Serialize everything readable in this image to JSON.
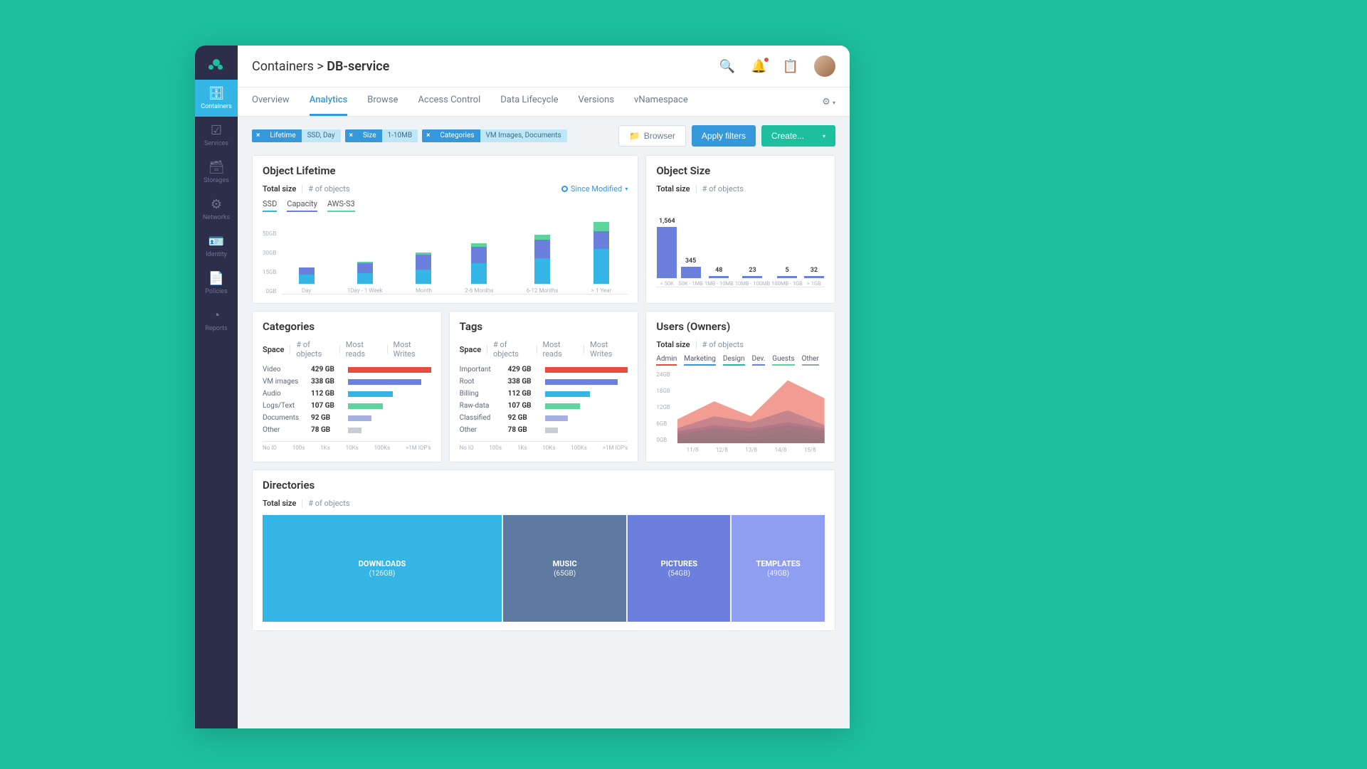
{
  "sidebar": [
    {
      "label": "Containers",
      "icon": "🗄"
    },
    {
      "label": "Services",
      "icon": "☑"
    },
    {
      "label": "Storages",
      "icon": "🗃"
    },
    {
      "label": "Networks",
      "icon": "⚙"
    },
    {
      "label": "Identity",
      "icon": "🪪"
    },
    {
      "label": "Policies",
      "icon": "📄"
    },
    {
      "label": "Reports",
      "icon": "◔"
    }
  ],
  "breadcrumb": {
    "parent": "Containers",
    "sep": ">",
    "current": "DB-service"
  },
  "tabs": [
    "Overview",
    "Analytics",
    "Browse",
    "Access Control",
    "Data Lifecycle",
    "Versions",
    "vNamespace"
  ],
  "active_tab": "Analytics",
  "chips": [
    {
      "label": "Lifetime",
      "value": "SSD, Day"
    },
    {
      "label": "Size",
      "value": "1-10MB"
    },
    {
      "label": "Categories",
      "value": "VM Images, Documents"
    }
  ],
  "buttons": {
    "browser": "Browser",
    "apply": "Apply filters",
    "create": "Create..."
  },
  "metric_tabs": {
    "total": "Total size",
    "num": "# of objects"
  },
  "lifetime": {
    "title": "Object Lifetime",
    "since": "Since Modified",
    "series_tabs": [
      {
        "name": "SSD",
        "color": "#35b5e6"
      },
      {
        "name": "Capacity",
        "color": "#6b7fdc"
      },
      {
        "name": "AWS-S3",
        "color": "#5dd39e"
      }
    ],
    "yaxis": [
      "50GB",
      "30GB",
      "15GB",
      "0GB"
    ]
  },
  "size": {
    "title": "Object Size"
  },
  "categories": {
    "title": "Categories",
    "metric_tabs": [
      "Space",
      "# of objects",
      "Most reads",
      "Most Writes"
    ],
    "rows": [
      {
        "name": "Video",
        "amt": "429 GB",
        "pct": 100,
        "color": "#e74c3c"
      },
      {
        "name": "VM images",
        "amt": "338 GB",
        "pct": 88,
        "color": "#6b7fdc"
      },
      {
        "name": "Audio",
        "amt": "112 GB",
        "pct": 54,
        "color": "#35b5e6"
      },
      {
        "name": "Logs/Text",
        "amt": "107 GB",
        "pct": 42,
        "color": "#5dd39e"
      },
      {
        "name": "Documents",
        "amt": "92 GB",
        "pct": 28,
        "color": "#a6b0e2"
      },
      {
        "name": "Other",
        "amt": "78 GB",
        "pct": 16,
        "color": "#c9ccd4"
      }
    ],
    "ioaxis": [
      "No IO",
      "100s",
      "1Ks",
      "10Ks",
      "100Ks",
      ">1M IOP's"
    ]
  },
  "tags": {
    "title": "Tags",
    "metric_tabs": [
      "Space",
      "# of objects",
      "Most reads",
      "Most Writes"
    ],
    "rows": [
      {
        "name": "Important",
        "amt": "429 GB",
        "pct": 100,
        "color": "#e74c3c"
      },
      {
        "name": "Root",
        "amt": "338 GB",
        "pct": 88,
        "color": "#6b7fdc"
      },
      {
        "name": "Billing",
        "amt": "112 GB",
        "pct": 54,
        "color": "#35b5e6"
      },
      {
        "name": "Raw-data",
        "amt": "107 GB",
        "pct": 42,
        "color": "#5dd39e"
      },
      {
        "name": "Classified",
        "amt": "92 GB",
        "pct": 28,
        "color": "#a6b0e2"
      },
      {
        "name": "Other",
        "amt": "78 GB",
        "pct": 16,
        "color": "#c9ccd4"
      }
    ],
    "ioaxis": [
      "No IO",
      "100s",
      "1Ks",
      "10Ks",
      "100Ks",
      ">1M IOP's"
    ]
  },
  "users": {
    "title": "Users (Owners)",
    "series": [
      {
        "name": "Admin",
        "color": "#e74c3c"
      },
      {
        "name": "Marketing",
        "color": "#3498db"
      },
      {
        "name": "Design",
        "color": "#1dbf9e"
      },
      {
        "name": "Dev.",
        "color": "#6b7fdc"
      },
      {
        "name": "Guests",
        "color": "#5dd39e"
      },
      {
        "name": "Other",
        "color": "#95a5a6"
      }
    ],
    "yaxis": [
      "24GB",
      "18GB",
      "12GB",
      "6GB",
      "0GB"
    ],
    "xaxis": [
      "11/8",
      "12/8",
      "13/8",
      "14/8",
      "15/8"
    ]
  },
  "directories": {
    "title": "Directories",
    "cells": [
      {
        "name": "Downloads",
        "size": "(126GB)",
        "gb": 126,
        "color": "#35b5e6"
      },
      {
        "name": "Music",
        "size": "(65GB)",
        "gb": 65,
        "color": "#5f7aa0"
      },
      {
        "name": "Pictures",
        "size": "(54GB)",
        "gb": 54,
        "color": "#6b7fdc"
      },
      {
        "name": "Templates",
        "size": "(49GB)",
        "gb": 49,
        "color": "#8f9ef0"
      }
    ]
  },
  "chart_data": {
    "lifetime_stacked_bar": {
      "type": "bar",
      "title": "Object Lifetime",
      "ylabel": "GB",
      "ylim": [
        0,
        55
      ],
      "categories": [
        "Day",
        "1Day - 1 Week",
        "Month",
        "2-6 Months",
        "6-12 Months",
        "> 1 Year"
      ],
      "series": [
        {
          "name": "SSD",
          "values": [
            8,
            9,
            12,
            18,
            22,
            30
          ]
        },
        {
          "name": "Capacity",
          "values": [
            6,
            9,
            13,
            14,
            16,
            15
          ]
        },
        {
          "name": "AWS-S3",
          "values": [
            0,
            1,
            2,
            3,
            4,
            8
          ]
        }
      ]
    },
    "object_size_bar": {
      "type": "bar",
      "title": "Object Size",
      "categories": [
        "< 50K",
        "50K - 1MB",
        "1MB - 10MB",
        "10MB - 100MB",
        "100MB - 1GB",
        "> 1GB"
      ],
      "values": [
        1564,
        345,
        48,
        23,
        5,
        32
      ]
    },
    "categories_hbar": {
      "type": "bar",
      "title": "Categories — Space",
      "categories": [
        "Video",
        "VM images",
        "Audio",
        "Logs/Text",
        "Documents",
        "Other"
      ],
      "values": [
        429,
        338,
        112,
        107,
        92,
        78
      ],
      "ylabel": "GB"
    },
    "tags_hbar": {
      "type": "bar",
      "title": "Tags — Space",
      "categories": [
        "Important",
        "Root",
        "Billing",
        "Raw-data",
        "Classified",
        "Other"
      ],
      "values": [
        429,
        338,
        112,
        107,
        92,
        78
      ],
      "ylabel": "GB"
    },
    "users_area": {
      "type": "area",
      "title": "Users (Owners)",
      "x": [
        "11/8",
        "12/8",
        "13/8",
        "14/8",
        "15/8"
      ],
      "ylabel": "GB",
      "ylim": [
        0,
        24
      ],
      "series": [
        {
          "name": "Admin",
          "values": [
            8,
            14,
            9,
            21,
            15
          ]
        },
        {
          "name": "Marketing",
          "values": [
            5,
            9,
            7,
            11,
            6
          ]
        },
        {
          "name": "Design",
          "values": [
            3,
            5,
            4,
            6,
            4
          ]
        },
        {
          "name": "Dev.",
          "values": [
            4,
            6,
            5,
            7,
            5
          ]
        },
        {
          "name": "Guests",
          "values": [
            2,
            3,
            2,
            4,
            2
          ]
        },
        {
          "name": "Other",
          "values": [
            1,
            2,
            1,
            2,
            1
          ]
        }
      ]
    },
    "directories_treemap": {
      "type": "table",
      "title": "Directories",
      "categories": [
        "Downloads",
        "Music",
        "Pictures",
        "Templates"
      ],
      "values": [
        126,
        65,
        54,
        49
      ],
      "ylabel": "GB"
    }
  }
}
